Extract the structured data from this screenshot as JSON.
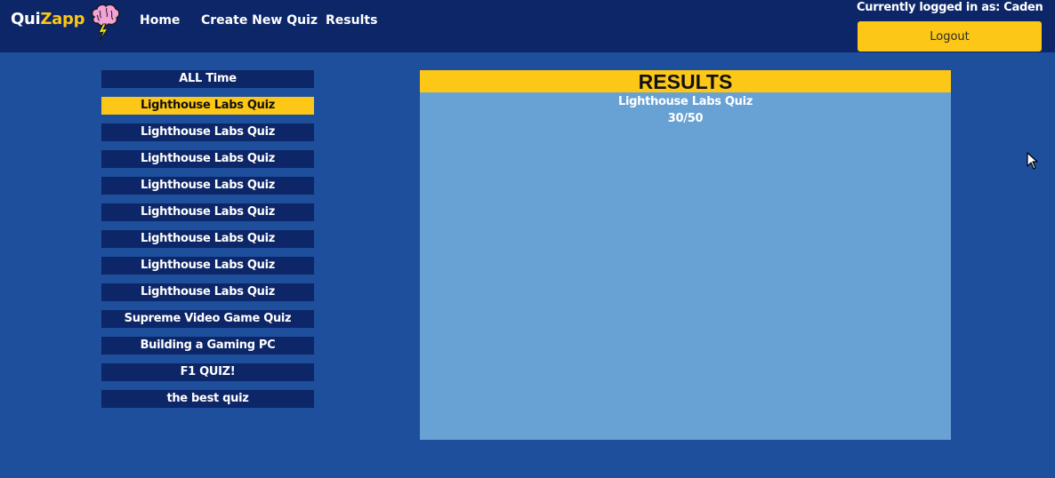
{
  "brand": {
    "part1": "Qui",
    "part2": "Zapp"
  },
  "nav": {
    "home": "Home",
    "create": "Create New Quiz",
    "results": "Results"
  },
  "user": {
    "status": "Currently logged in as: Caden",
    "logout": "Logout"
  },
  "sidebar": {
    "items": [
      {
        "label": "ALL Time",
        "active": false
      },
      {
        "label": "Lighthouse Labs Quiz",
        "active": true
      },
      {
        "label": "Lighthouse Labs Quiz",
        "active": false
      },
      {
        "label": "Lighthouse Labs Quiz",
        "active": false
      },
      {
        "label": "Lighthouse Labs Quiz",
        "active": false
      },
      {
        "label": "Lighthouse Labs Quiz",
        "active": false
      },
      {
        "label": "Lighthouse Labs Quiz",
        "active": false
      },
      {
        "label": "Lighthouse Labs Quiz",
        "active": false
      },
      {
        "label": "Lighthouse Labs Quiz",
        "active": false
      },
      {
        "label": "Supreme Video Game Quiz",
        "active": false
      },
      {
        "label": "Building a Gaming PC",
        "active": false
      },
      {
        "label": "F1 QUIZ!",
        "active": false
      },
      {
        "label": "the best quiz",
        "active": false
      }
    ]
  },
  "results": {
    "title": "RESULTS",
    "quiz_name": "Lighthouse Labs Quiz",
    "score": "30/50"
  },
  "colors": {
    "navbar": "#0c2668",
    "background": "#1e4f9c",
    "accent": "#fcc716",
    "panel": "#68a2d5"
  },
  "icons": {
    "logo": "brain-lightning-icon",
    "cursor": "mouse-pointer-icon"
  }
}
